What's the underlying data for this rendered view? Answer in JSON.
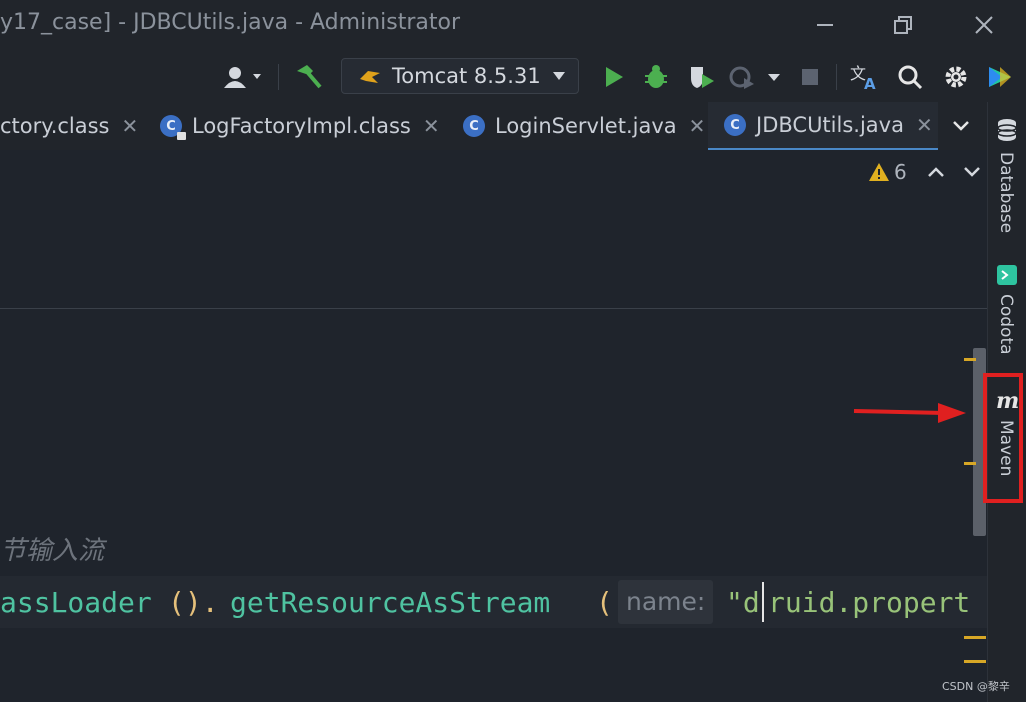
{
  "window": {
    "title": "y17_case] - JDBCUtils.java - Administrator"
  },
  "toolbar": {
    "run_config": "Tomcat 8.5.31"
  },
  "tabs": [
    {
      "label": "ctory.class",
      "icon": "class-icon",
      "active": false
    },
    {
      "label": "LogFactoryImpl.class",
      "icon": "class-locked-icon",
      "active": false
    },
    {
      "label": "LoginServlet.java",
      "icon": "class-icon",
      "active": false
    },
    {
      "label": "JDBCUtils.java",
      "icon": "class-icon",
      "active": true
    }
  ],
  "editor": {
    "warning_count": "6",
    "comment_text": "节输入流",
    "code": {
      "part1": "assLoader",
      "part2": "().",
      "part3": "getResourceAsStream",
      "part4": "(",
      "hint": "name:",
      "string_open": "\"d",
      "string_rest": "ruid.propert"
    }
  },
  "right_panels": {
    "database": "Database",
    "codota": "Codota",
    "maven": "Maven"
  },
  "watermark": "CSDN @黎辛",
  "colors": {
    "accent_blue": "#4a88c7",
    "run_green": "#4caf50",
    "highlight_red": "#e02020",
    "warning_yellow": "#d7a726"
  }
}
